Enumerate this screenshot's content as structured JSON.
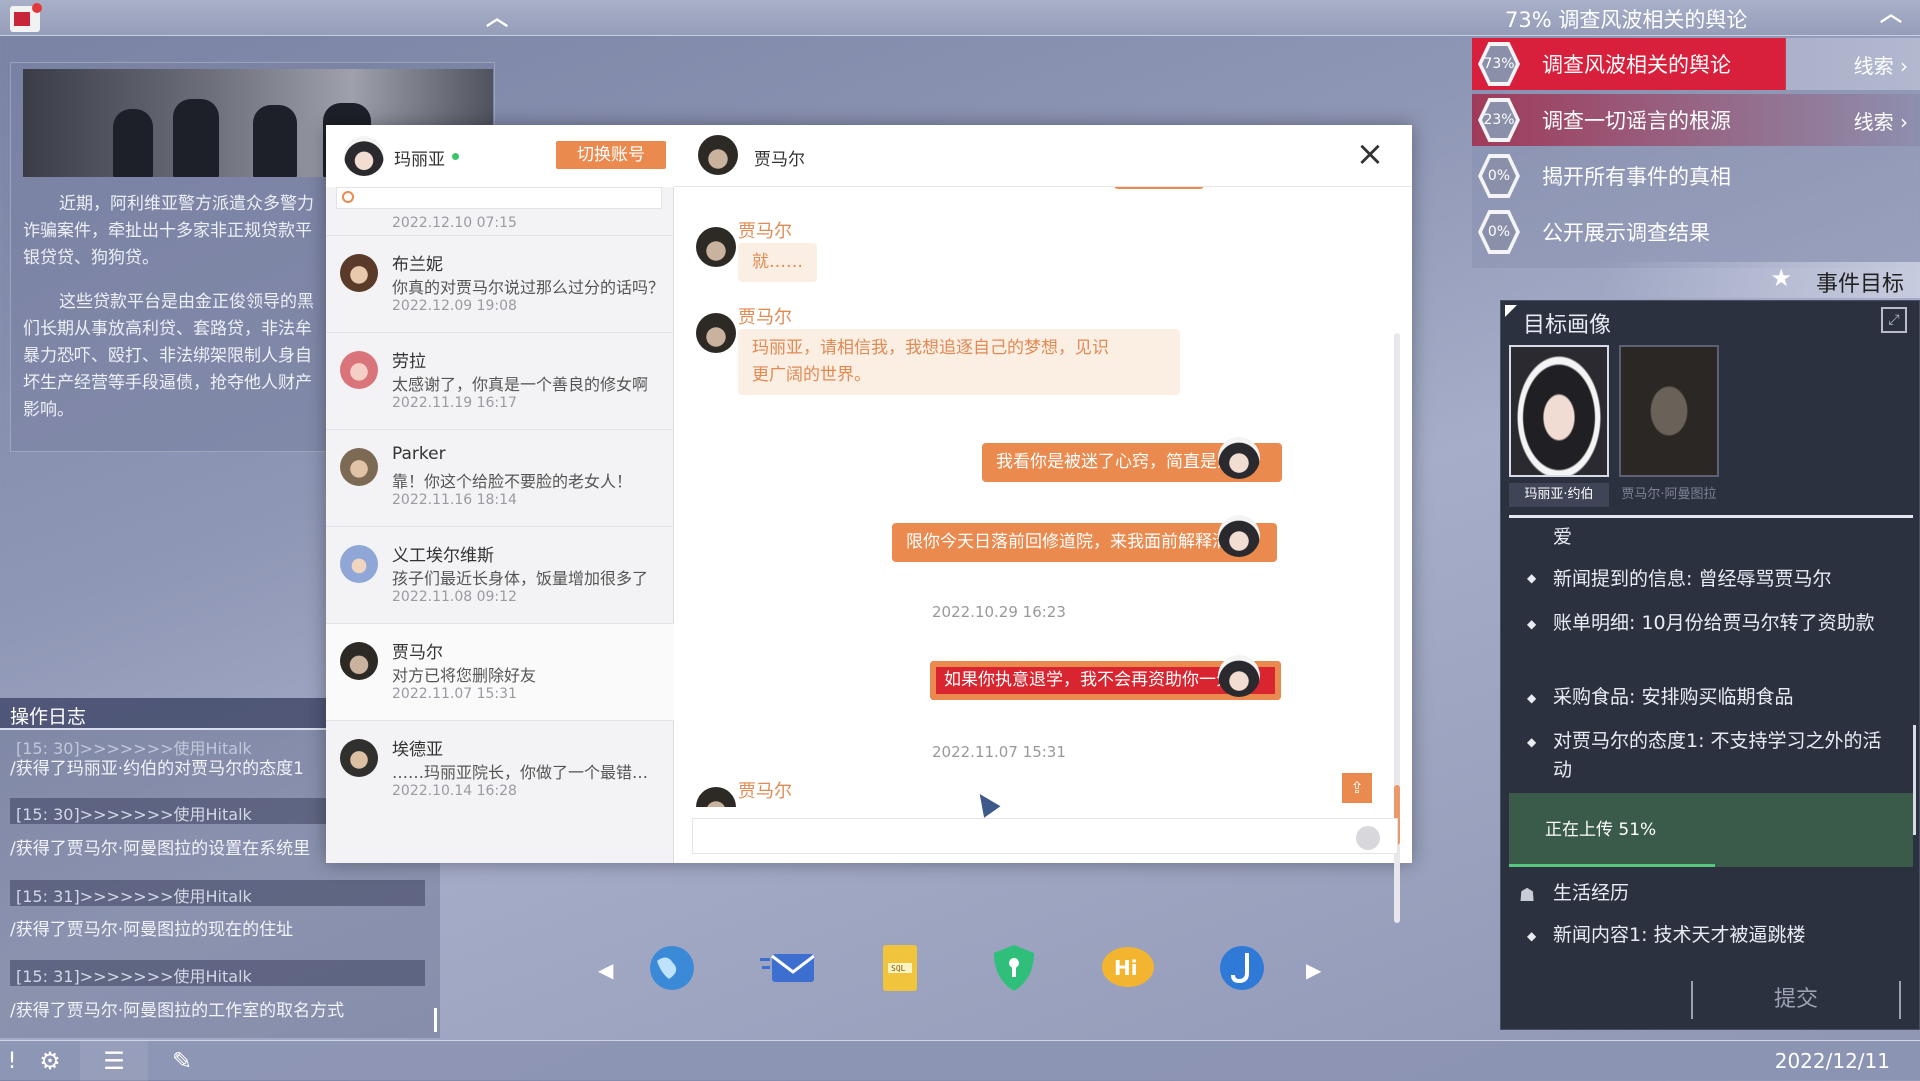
{
  "topbar": {
    "status": "73%  调查风波相关的舆论"
  },
  "news": {
    "para1": "近期，阿利维亚警方派遣众多警力\n诈骗案件，牵扯出十多家非正规贷款平\n银贷贷、狗狗贷。",
    "para2": "这些贷款平台是由金正俊领导的黑\n们长期从事放高利贷、套路贷，非法牟\n暴力恐吓、殴打、非法绑架限制人身自\n坏生产经营等手段逼债，抢夺他人财产\n影响。"
  },
  "oplog": {
    "title": "操作日志",
    "entries": [
      {
        "ts": "[15: 30]>>>>>>>使用Hitalk",
        "text": "/获得了玛丽亚·约伯的对贾马尔的态度1"
      },
      {
        "ts": "[15: 30]>>>>>>>使用Hitalk",
        "text": "/获得了贾马尔·阿曼图拉的设置在系统里"
      },
      {
        "ts": "[15: 31]>>>>>>>使用Hitalk",
        "text": "/获得了贾马尔·阿曼图拉的现在的住址"
      },
      {
        "ts": "[15: 31]>>>>>>>使用Hitalk",
        "text": "/获得了贾马尔·阿曼图拉的工作室的取名方式"
      }
    ]
  },
  "chat": {
    "me": {
      "name": "玛丽亚",
      "switch_label": "切换账号"
    },
    "top_stamp": "2022.12.10  07:15",
    "contacts": [
      {
        "name": "布兰妮",
        "msg": "你真的对贾马尔说过那么过分的话吗？",
        "time": "2022.12.09  19:08"
      },
      {
        "name": "劳拉",
        "msg": "太感谢了，你真是一个善良的修女啊",
        "time": "2022.11.19  16:17"
      },
      {
        "name": "Parker",
        "msg": "靠！你这个给脸不要脸的老女人！",
        "time": "2022.11.16  18:14"
      },
      {
        "name": "义工埃尔维斯",
        "msg": "孩子们最近长身体，饭量增加很多了",
        "time": "2022.11.08  09:12"
      },
      {
        "name": "贾马尔",
        "msg": "对方已将您删除好友",
        "time": "2022.11.07  15:31"
      },
      {
        "name": "埃德亚",
        "msg": "……玛丽亚院长，你做了一个最错误的决定",
        "time": "2022.10.14  16:28"
      }
    ],
    "partner": "贾马尔",
    "messages": {
      "m1_sender": "贾马尔",
      "m1": "就……",
      "m2_sender": "贾马尔",
      "m2": "玛丽亚，请相信我，我想追逐自己的梦想，见识\n更广阔的世界。",
      "m3": "我看你是被迷了心窍，简直是愚蠢！",
      "m4": "限你今天日落前回修道院，来我面前解释清楚！",
      "stamp1": "2022.10.29  16:23",
      "m5": "如果你执意退学，我不会再资助你一分钱！",
      "stamp2": "2022.11.07  15:31",
      "m6_sender": "贾马尔"
    }
  },
  "objectives": [
    {
      "pct": "73%",
      "text": "调查风波相关的舆论",
      "clue": "线索 ›"
    },
    {
      "pct": "23%",
      "text": "调查一切谣言的根源",
      "clue": "线索 ›"
    },
    {
      "pct": "0%",
      "text": "揭开所有事件的真相",
      "clue": ""
    },
    {
      "pct": "0%",
      "text": "公开展示调查结果",
      "clue": ""
    }
  ],
  "goal_header": "事件目标",
  "profile": {
    "title": "目标画像",
    "targets": [
      "玛丽亚·约伯",
      "贾马尔·阿曼图拉"
    ],
    "partial": "爱",
    "facts": [
      "新闻提到的信息: 曾经辱骂贾马尔",
      "账单明细: 10月份给贾马尔转了资助款",
      "采购食品: 安排购买临期食品",
      "对贾马尔的态度1: 不支持学习之外的活动"
    ],
    "upload_text": "正在上传  51%",
    "upload_progress": 0.51,
    "section2": "生活经历",
    "life": [
      "新闻内容1: 技术天才被逼跳楼"
    ],
    "submit": "提交"
  },
  "bottom": {
    "date": "2022/12/11"
  },
  "colors": {
    "accent": "#ea8a4e",
    "active_objective": "#d81f3b",
    "panel_dark": "#2c313f"
  }
}
